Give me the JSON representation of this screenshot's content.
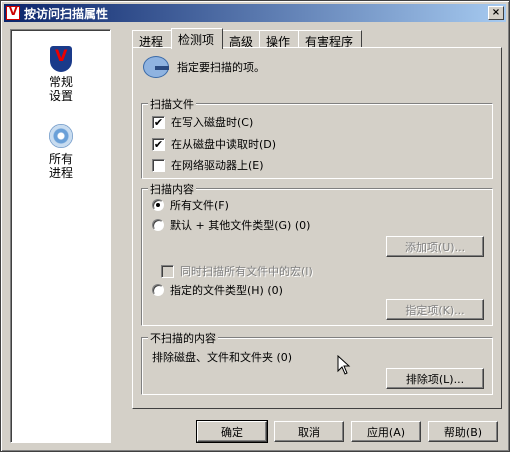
{
  "window": {
    "title": "按访问扫描属性",
    "close": "×"
  },
  "sidebar": {
    "items": [
      {
        "label_line1": "常规",
        "label_line2": "设置",
        "icon": "shield-icon"
      },
      {
        "label_line1": "所有",
        "label_line2": "进程",
        "icon": "disc-icon"
      }
    ]
  },
  "tabs": [
    "进程",
    "检测项",
    "高级",
    "操作",
    "有害程序"
  ],
  "active_tab": 1,
  "panel": {
    "intro_text": "指定要扫描的项。",
    "scan_files": {
      "title": "扫描文件",
      "options": [
        {
          "label": "在写入磁盘时(C)",
          "checked": "✔"
        },
        {
          "label": "在从磁盘中读取时(D)",
          "checked": "✔"
        },
        {
          "label": "在网络驱动器上(E)",
          "checked": ""
        }
      ]
    },
    "scan_content": {
      "title": "扫描内容",
      "all_files": "所有文件(F)",
      "default_plus": "默认 + 其他文件类型(G) (0)",
      "add_button": "添加项(U)...",
      "macros": "同时扫描所有文件中的宏(I)",
      "specified": "指定的文件类型(H) (0)",
      "specify_button": "指定项(K)..."
    },
    "exclusions": {
      "title": "不扫描的内容",
      "text": "排除磁盘、文件和文件夹 (0)",
      "button": "排除项(L)..."
    }
  },
  "footer": {
    "ok": "确定",
    "cancel": "取消",
    "apply": "应用(A)",
    "help": "帮助(B)"
  }
}
